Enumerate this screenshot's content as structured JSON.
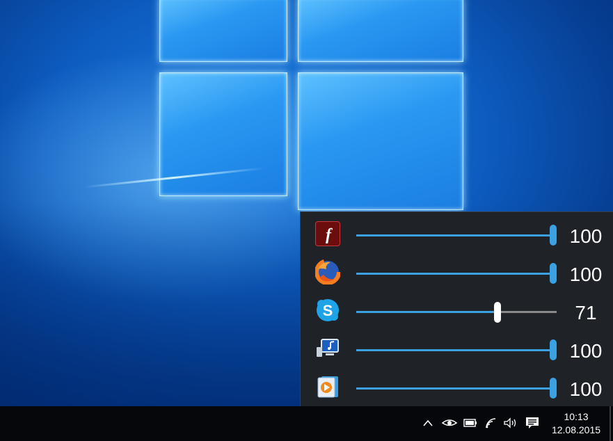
{
  "mixer": {
    "apps": [
      {
        "name": "flash-player",
        "icon": "flash-icon",
        "value": "100",
        "level": 1.0,
        "active": false
      },
      {
        "name": "firefox",
        "icon": "firefox-icon",
        "value": "100",
        "level": 1.0,
        "active": false
      },
      {
        "name": "skype",
        "icon": "skype-icon",
        "value": "71",
        "level": 0.71,
        "active": true
      },
      {
        "name": "system-sounds",
        "icon": "system-sounds-icon",
        "value": "100",
        "level": 1.0,
        "active": false
      },
      {
        "name": "media-player",
        "icon": "media-player-icon",
        "value": "100",
        "level": 1.0,
        "active": false
      }
    ],
    "accent": "#3aa1e3",
    "background": "#1f2226"
  },
  "taskbar": {
    "tray_icons": [
      "chevron-up-icon",
      "eye-icon",
      "battery-icon",
      "wifi-icon",
      "speaker-icon",
      "action-center-icon"
    ],
    "time": "10:13",
    "date": "12.08.2015",
    "background": "#06070a"
  }
}
